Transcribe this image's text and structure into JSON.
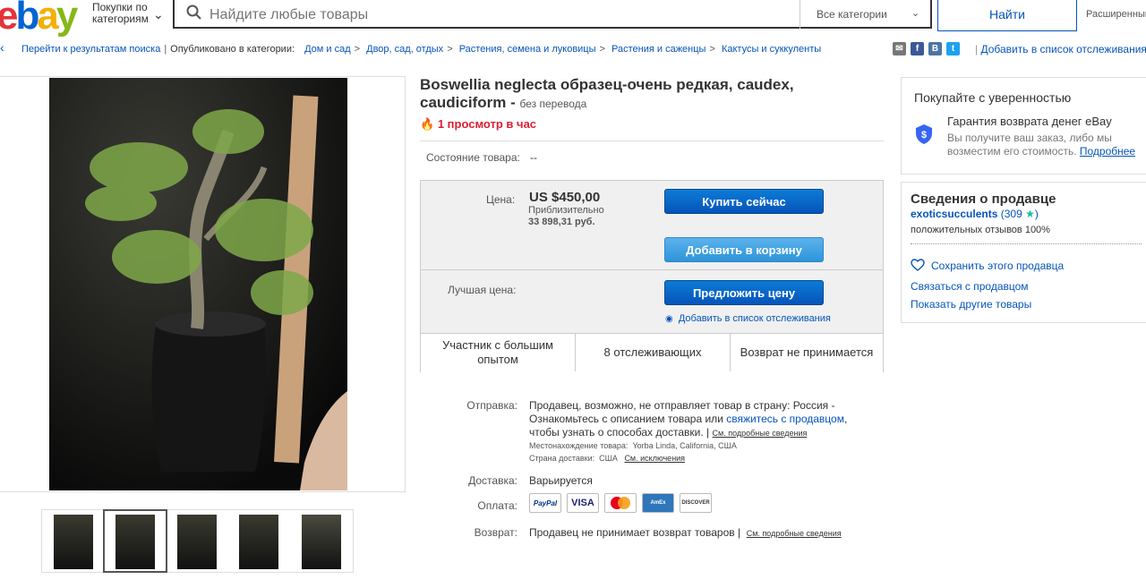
{
  "header": {
    "logo_letters": [
      "e",
      "b",
      "a",
      "y"
    ],
    "shop_by": "Покупки по категориям",
    "search_placeholder": "Найдите любые товары",
    "category_select": "Все категории",
    "search_button": "Найти",
    "advanced": "Расширенный"
  },
  "breadcrumb": {
    "back": "Перейти к результатам поиска",
    "published_in": "Опубликовано в категории:",
    "items": [
      "Дом и сад",
      "Двор, сад, отдых",
      "Растения, семена и луковицы",
      "Растения и саженцы",
      "Кактусы и суккуленты"
    ],
    "watch_link": "Добавить в список отслеживания"
  },
  "share_icons": [
    "email-icon",
    "facebook-icon",
    "vk-icon",
    "twitter-icon"
  ],
  "listing": {
    "title": "Boswellia neglecta образец-очень редкая, caudex, caudiciform -",
    "title_note": "без перевода",
    "views": "1 просмотр в час",
    "condition_label": "Состояние товара:",
    "condition_value": "--",
    "price_label": "Цена:",
    "price": "US $450,00",
    "approx_label": "Приблизительно",
    "approx_value": "33 898,31 руб.",
    "buy_now": "Купить сейчас",
    "add_to_cart": "Добавить в корзину",
    "best_offer_label": "Лучшая цена:",
    "make_offer": "Предложить цену",
    "add_watch": "Добавить в список отслеживания",
    "info_cells": [
      "Участник с большим опытом",
      "8 отслеживающих",
      "Возврат не принимается"
    ]
  },
  "details": {
    "shipping_label": "Отправка:",
    "shipping_text_1": "Продавец, возможно, не отправляет товар в страну: Россия -",
    "shipping_text_2": "Ознакомьтесь с описанием товара или",
    "shipping_contact": "свяжитесь с продавцом",
    "shipping_text_3": "чтобы узнать о способах доставки. |",
    "shipping_details_link": "См. подробные сведения",
    "location_label": "Местонахождение товара:",
    "location": "Yorba Linda, California, США",
    "country_label": "Страна доставки:",
    "country": "США",
    "exclusions_link": "См. исключения",
    "delivery_label": "Доставка:",
    "delivery_value": "Варьируется",
    "payment_label": "Оплата:",
    "payment_methods": [
      "PayPal",
      "VISA",
      "MasterCard",
      "AmEx",
      "DISCOVER"
    ],
    "returns_label": "Возврат:",
    "returns_value": "Продавец не принимает возврат товаров |",
    "returns_link": "См. подробные сведения"
  },
  "confidence": {
    "title": "Покупайте с уверенностью",
    "guarantee_title": "Гарантия возврата денег eBay",
    "guarantee_desc": "Вы получите ваш заказ, либо мы возместим его стоимость.",
    "more": "Подробнее"
  },
  "seller": {
    "title": "Сведения о продавце",
    "name": "exoticsucculents",
    "score": "(309",
    "score_end": ")",
    "positive": "положительных отзывов 100%",
    "save": "Сохранить этого продавца",
    "contact": "Связаться с продавцом",
    "other_items": "Показать другие товары"
  },
  "colors": {
    "ebay_red": "#e53238",
    "ebay_blue": "#0064d2",
    "ebay_yellow": "#f5af02",
    "ebay_green": "#86b817",
    "link": "#0654ba",
    "button_blue": "#0654ba",
    "views_red": "#dd1e31"
  }
}
